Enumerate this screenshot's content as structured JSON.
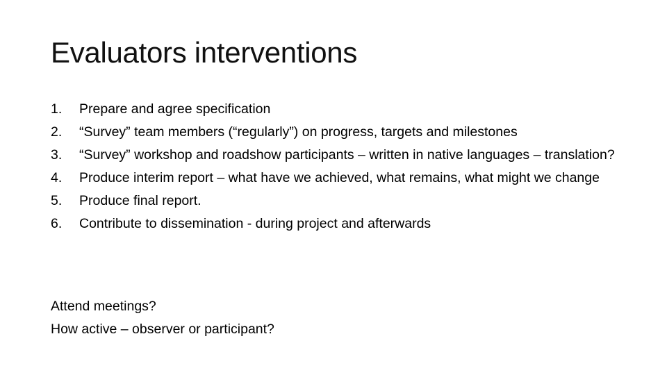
{
  "slide": {
    "title": "Evaluators interventions",
    "items": [
      {
        "number": "1.",
        "text": "Prepare and agree specification"
      },
      {
        "number": "2.",
        "text": "“Survey” team members (“regularly”) on progress, targets and milestones"
      },
      {
        "number": "3.",
        "text": "“Survey” workshop and roadshow participants – written in native languages – translation?"
      },
      {
        "number": "4.",
        "text": "Produce interim report – what have we achieved, what remains, what might we change"
      },
      {
        "number": "5.",
        "text": "Produce final report."
      },
      {
        "number": "6.",
        "text": "Contribute to dissemination - during project and afterwards"
      }
    ],
    "notes": [
      "Attend meetings?",
      "How active – observer or participant?"
    ]
  }
}
